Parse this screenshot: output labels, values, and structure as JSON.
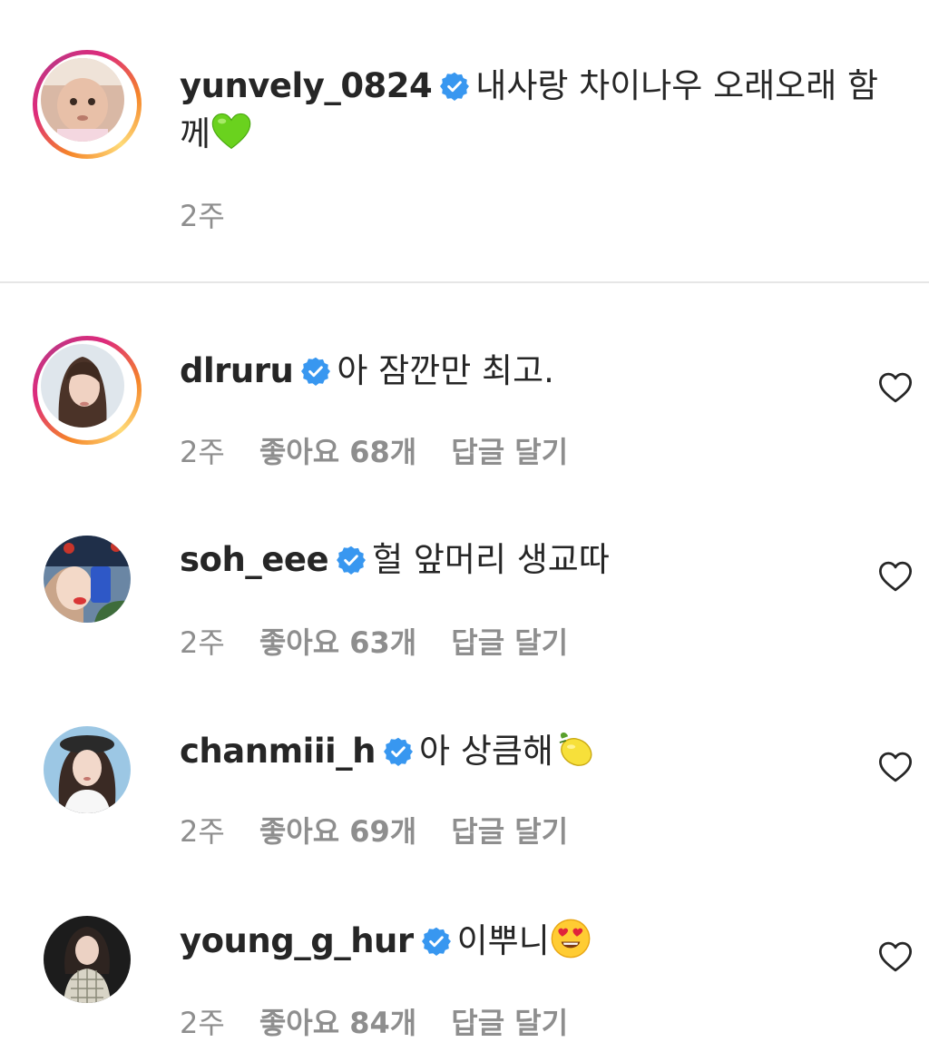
{
  "caption": {
    "username": "yunvely_0824",
    "text_line1": "내사랑 차이나우 오래오래 함",
    "text_line2": "께",
    "emoji": "green-heart",
    "time": "2주"
  },
  "comments": [
    {
      "username": "dlruru",
      "text": "아 잠깐만 최고.",
      "time": "2주",
      "likes": "좋아요 68개",
      "reply": "답글 달기",
      "has_story_ring": true
    },
    {
      "username": "soh_eee",
      "text": "헐 앞머리 생교따",
      "time": "2주",
      "likes": "좋아요 63개",
      "reply": "답글 달기",
      "has_story_ring": false
    },
    {
      "username": "chanmiii_h",
      "text": "아 상큼해",
      "emoji": "lemon",
      "time": "2주",
      "likes": "좋아요 69개",
      "reply": "답글 달기",
      "has_story_ring": false
    },
    {
      "username": "young_g_hur",
      "text": "이뿌니",
      "emoji": "heart-eyes-face",
      "time": "2주",
      "likes": "좋아요 84개",
      "reply": "답글 달기",
      "has_story_ring": false
    }
  ],
  "colors": {
    "text": "#262626",
    "meta": "#8e8e8e",
    "verified_blue": "#3897f0",
    "divider": "#e6e6e6"
  }
}
